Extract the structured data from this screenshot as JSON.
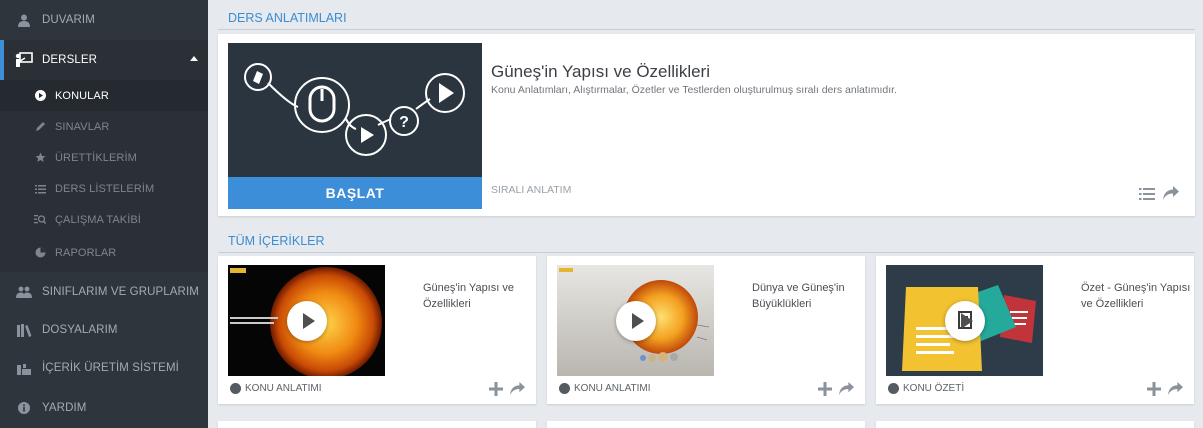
{
  "sidebar": {
    "items": [
      {
        "label": "DUVARIM",
        "icon": "user-icon"
      },
      {
        "label": "DERSLER",
        "icon": "teacher-board-icon"
      },
      {
        "label": "KONULAR",
        "icon": "play-circle-icon"
      },
      {
        "label": "SINAVLAR",
        "icon": "pencil-icon"
      },
      {
        "label": "ÜRETTİKLERİM",
        "icon": "star-icon"
      },
      {
        "label": "DERS LİSTELERİM",
        "icon": "list-icon"
      },
      {
        "label": "ÇALIŞMA TAKİBİ",
        "icon": "search-list-icon"
      },
      {
        "label": "RAPORLAR",
        "icon": "pie-chart-icon"
      },
      {
        "label": "SINIFLARIM VE GRUPLARIM",
        "icon": "users-icon"
      },
      {
        "label": "DOSYALARIM",
        "icon": "books-icon"
      },
      {
        "label": "İÇERİK ÜRETİM SİSTEMİ",
        "icon": "production-icon"
      },
      {
        "label": "YARDIM",
        "icon": "info-icon"
      }
    ]
  },
  "featured": {
    "section_title": "DERS ANLATIMLARI",
    "title": "Güneş'in Yapısı ve Özellikleri",
    "description": "Konu Anlatımları, Alıştırmalar, Özetler ve Testlerden oluşturulmuş sıralı ders anlatımıdır.",
    "start_label": "BAŞLAT",
    "type_label": "SIRALI ANLATIM"
  },
  "all_contents": {
    "section_title": "TÜM İÇERİKLER",
    "cards": [
      {
        "title": "Güneş'in Yapısı ve Özellikleri",
        "type": "KONU ANLATIMI"
      },
      {
        "title": "Dünya ve Güneş'in Büyüklükleri",
        "type": "KONU ANLATIMI"
      },
      {
        "title": "Özet - Güneş'in Yapısı ve Özellikleri",
        "type": "KONU ÖZETİ"
      }
    ]
  },
  "colors": {
    "accent": "#3d8ed8",
    "sidebar": "#2f353c",
    "background": "#e6e9ed"
  }
}
